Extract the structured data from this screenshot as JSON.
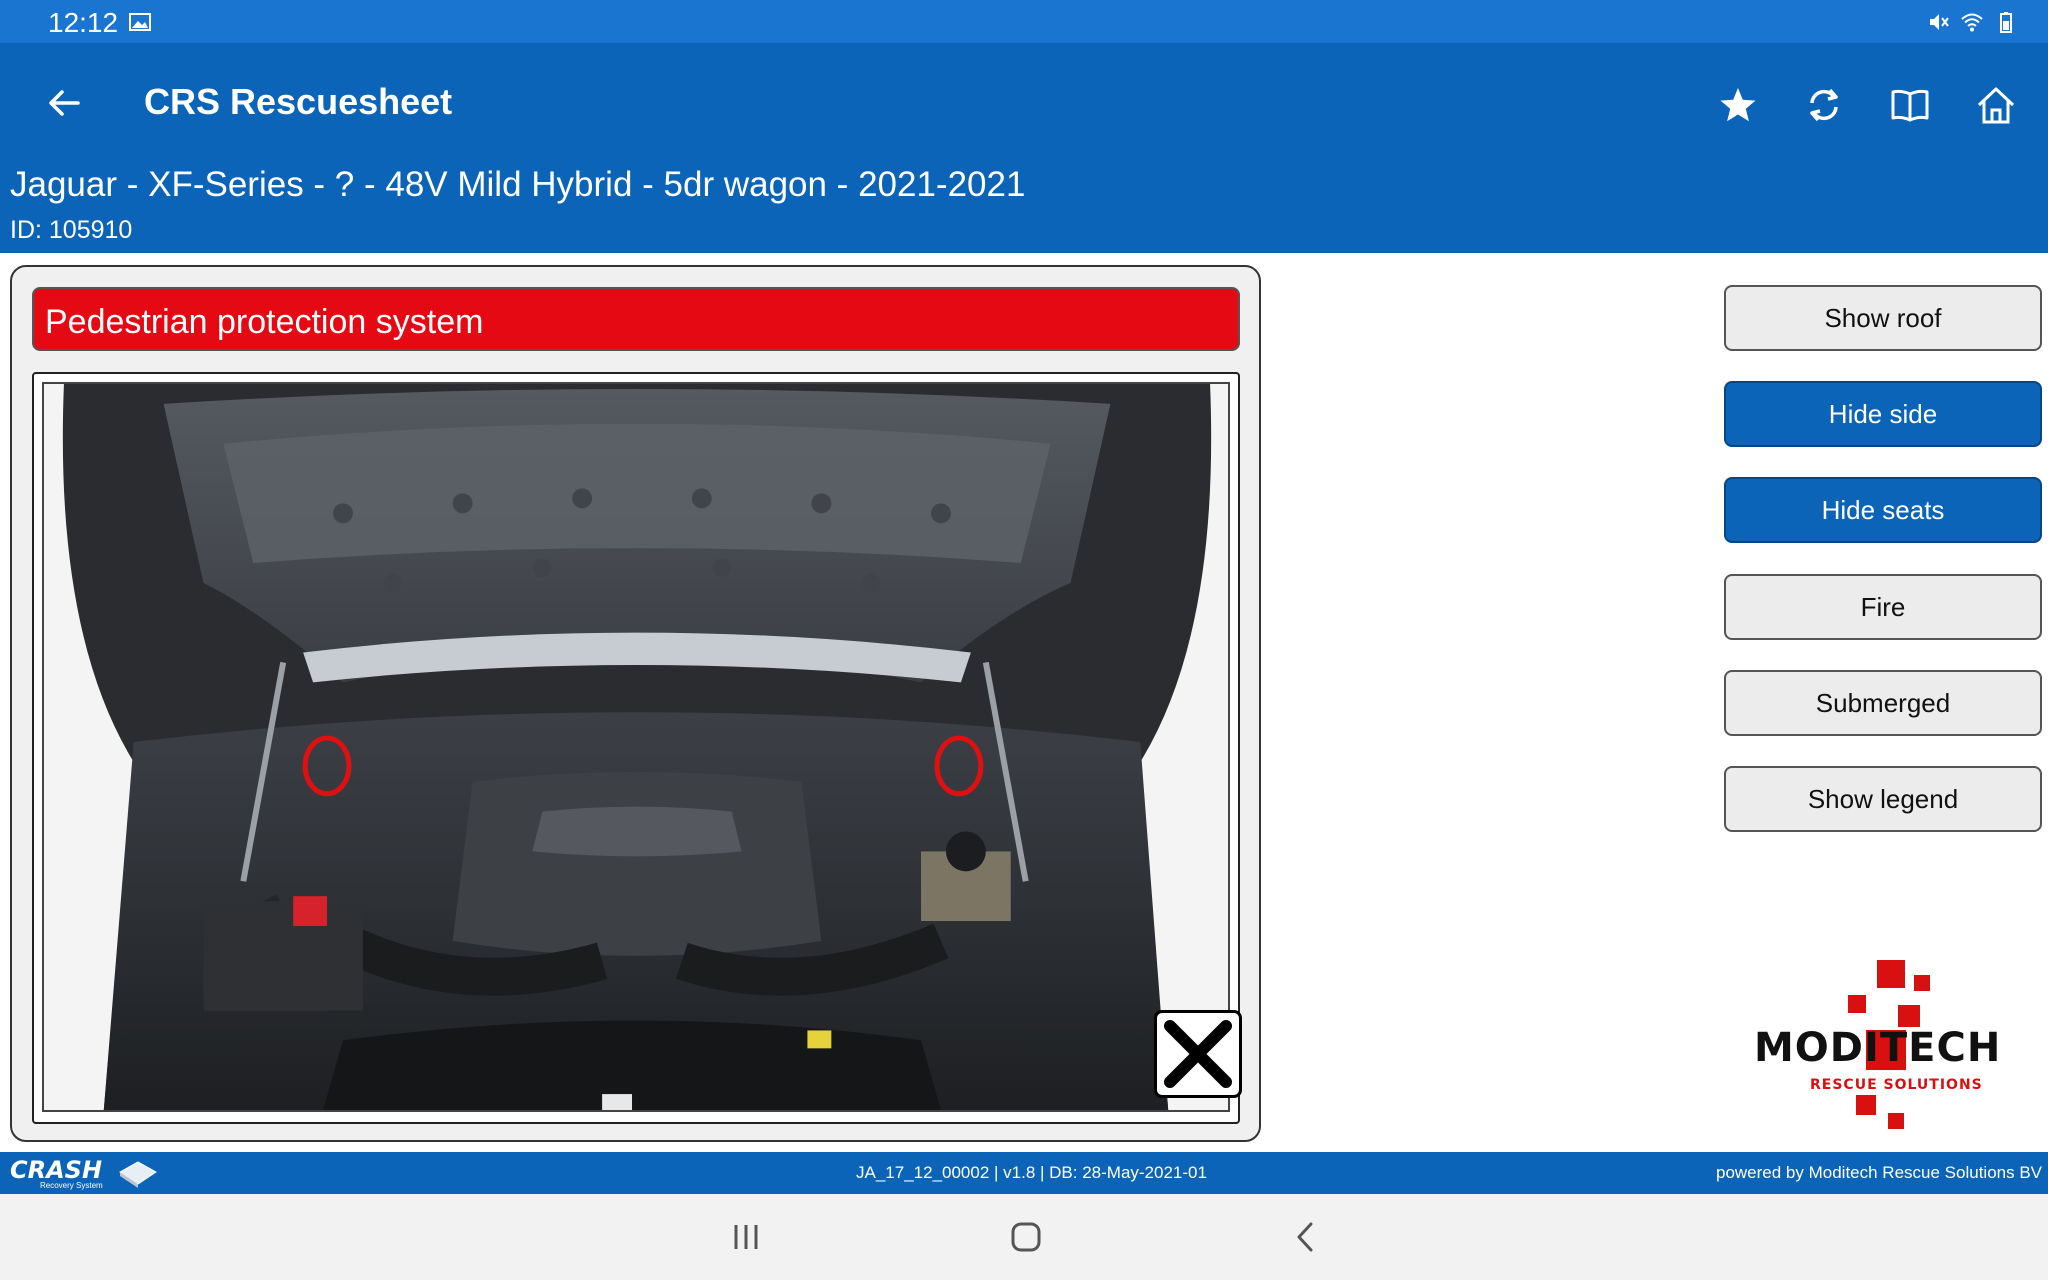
{
  "status_bar": {
    "time": "12:12",
    "icons": [
      "image-icon",
      "mute-icon",
      "wifi-icon",
      "battery-icon"
    ]
  },
  "app_bar": {
    "title": "CRS Rescuesheet",
    "actions": [
      "star-icon",
      "refresh-icon",
      "book-icon",
      "home-icon"
    ]
  },
  "vehicle": {
    "title": "Jaguar - XF-Series - ? - 48V Mild Hybrid - 5dr wagon - 2021-2021",
    "id": "ID: 105910"
  },
  "panel": {
    "header": "Pedestrian protection system",
    "image_description_icon": "engine-bay-photo",
    "close_icon": "close-icon"
  },
  "side_buttons": [
    {
      "label": "Show roof",
      "active": false
    },
    {
      "label": "Hide side",
      "active": true
    },
    {
      "label": "Hide seats",
      "active": true
    },
    {
      "label": "Fire",
      "active": false
    },
    {
      "label": "Submerged",
      "active": false
    },
    {
      "label": "Show legend",
      "active": false
    }
  ],
  "logo": {
    "word": "MODITECH",
    "sub": "RESCUE SOLUTIONS"
  },
  "footer": {
    "brand": "CRASH",
    "brand_sub": "Recovery System",
    "center": "JA_17_12_00002 | v1.8 | DB: 28-May-2021-01",
    "right": "powered by Moditech Rescue Solutions BV"
  },
  "colors": {
    "status_bar": "#1a75d0",
    "app_bar": "#0b64b8",
    "header_red": "#e50914",
    "button_dark": "#0b64b8",
    "button_light": "#ececec"
  }
}
